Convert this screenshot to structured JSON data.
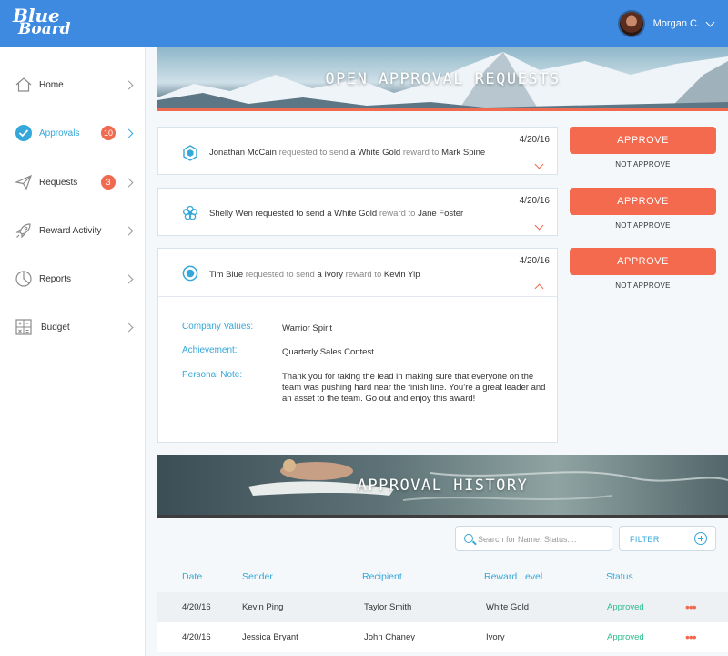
{
  "brand": {
    "logo_line1": "Blue",
    "logo_line2": "Board"
  },
  "user": {
    "name": "Morgan C."
  },
  "sidebar": {
    "items": [
      {
        "label": "Home",
        "icon": "home-icon"
      },
      {
        "label": "Approvals",
        "icon": "check-circle-icon",
        "badge": "10",
        "active": true
      },
      {
        "label": "Requests",
        "icon": "paper-plane-icon",
        "badge": "3"
      },
      {
        "label": "Reward Activity",
        "icon": "rocket-icon"
      },
      {
        "label": "Reports",
        "icon": "pie-chart-icon"
      },
      {
        "label": "Budget",
        "icon": "calculator-icon"
      }
    ]
  },
  "open_requests": {
    "title": "OPEN APPROVAL REQUESTS",
    "requests": [
      {
        "date": "4/20/16",
        "requester": "Jonathan McCain",
        "verb": "requested to send",
        "article": "a",
        "reward": "White Gold",
        "connector": "reward to",
        "recipient": "Mark Spine"
      },
      {
        "date": "4/20/16",
        "requester": "Shelly Wen",
        "verb": "requested to send",
        "article": "a",
        "reward": "White Gold",
        "connector": "reward to",
        "recipient": "Jane Foster"
      },
      {
        "date": "4/20/16",
        "requester": "Tim Blue",
        "verb": "requested to send",
        "article": "a",
        "reward": "Ivory",
        "connector": "reward to",
        "recipient": "Kevin Yip"
      }
    ],
    "approve_label": "APPROVE",
    "not_approve_label": "NOT APPROVE",
    "detail": {
      "company_values_label": "Company Values:",
      "company_values": "Warrior Spirit",
      "achievement_label": "Achievement:",
      "achievement": "Quarterly Sales Contest",
      "note_label": "Personal Note:",
      "note": "Thank you for taking the lead in making sure that everyone on the team was pushing hard near the finish line. You’re a great leader and an asset to the team. Go out and enjoy this award!"
    }
  },
  "history": {
    "title": "APPROVAL HISTORY",
    "search_placeholder": "Search for Name, Status....",
    "filter_label": "FILTER",
    "columns": [
      "Date",
      "Sender",
      "Recipient",
      "Reward Level",
      "Status"
    ],
    "rows": [
      {
        "date": "4/20/16",
        "sender": "Kevin Ping",
        "recipient": "Taylor Smith",
        "level": "White Gold",
        "status": "Approved"
      },
      {
        "date": "4/20/16",
        "sender": "Jessica Bryant",
        "recipient": "John Chaney",
        "level": "Ivory",
        "status": "Approved"
      }
    ]
  },
  "colors": {
    "header": "#3d8ae0",
    "accent": "#35a7d8",
    "approve": "#f46a4f",
    "approved_status": "#2dbd8f"
  }
}
